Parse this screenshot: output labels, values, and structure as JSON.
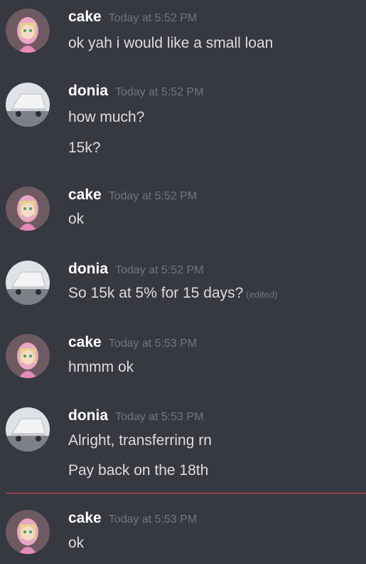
{
  "messages": [
    {
      "author": "cake",
      "timestamp": "Today at 5:52 PM",
      "lines": [
        {
          "text": "ok yah i would like a small loan"
        }
      ]
    },
    {
      "author": "donia",
      "timestamp": "Today at 5:52 PM",
      "lines": [
        {
          "text": "how much?"
        },
        {
          "text": "15k?"
        }
      ]
    },
    {
      "author": "cake",
      "timestamp": "Today at 5:52 PM",
      "lines": [
        {
          "text": "ok"
        }
      ]
    },
    {
      "author": "donia",
      "timestamp": "Today at 5:52 PM",
      "lines": [
        {
          "text": "So 15k at 5% for 15 days?",
          "edited": "(edited)"
        }
      ]
    },
    {
      "author": "cake",
      "timestamp": "Today at 5:53 PM",
      "lines": [
        {
          "text": "hmmm ok"
        }
      ]
    },
    {
      "author": "donia",
      "timestamp": "Today at 5:53 PM",
      "lines": [
        {
          "text": "Alright, transferring rn"
        },
        {
          "text": "Pay back on the 18th"
        }
      ]
    },
    {
      "author": "cake",
      "timestamp": "Today at 5:53 PM",
      "lines": [
        {
          "text": "ok"
        }
      ]
    }
  ],
  "colors": {
    "background": "#36393f",
    "username": "#ffffff",
    "message_text": "#dcddde",
    "timestamp": "#72767d",
    "new_messages_divider": "#d84a4a"
  },
  "avatars": {
    "cake": "anime-girl-pink-hoodie-avatar",
    "donia": "truck-avatar"
  }
}
